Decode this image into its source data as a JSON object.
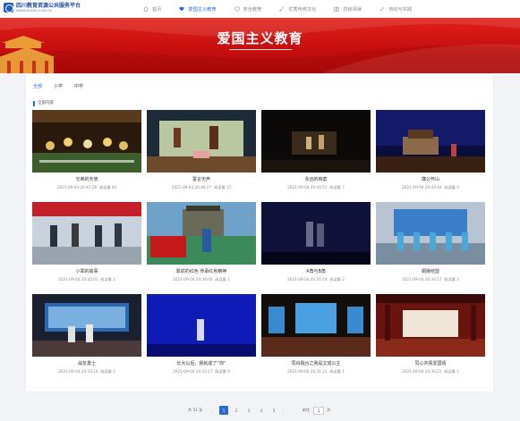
{
  "header": {
    "logo_title": "四川教育资源公共服务平台",
    "logo_url": "WWW.SCEDU.COM.CN",
    "nav": [
      {
        "label": "首页",
        "icon": "home-icon",
        "active": false
      },
      {
        "label": "爱国主义教育",
        "icon": "heart-icon",
        "active": true
      },
      {
        "label": "安全教育",
        "icon": "shield-icon",
        "active": false
      },
      {
        "label": "优秀传统文化",
        "icon": "brush-icon",
        "active": false
      },
      {
        "label": "抗疫阅读",
        "icon": "book-icon",
        "active": false
      },
      {
        "label": "劳动与实践",
        "icon": "tools-icon",
        "active": false
      }
    ]
  },
  "banner": {
    "title": "爱国主义教育"
  },
  "tabs": [
    {
      "label": "全部",
      "active": true
    },
    {
      "label": "小学",
      "active": false
    },
    {
      "label": "中学",
      "active": false
    }
  ],
  "section_label": "全部内容",
  "views_label": "阅读量",
  "items": [
    {
      "title": "光荣的天使",
      "date": "2021-09-04 20:47:26",
      "views": "44"
    },
    {
      "title": "誓言无声",
      "date": "2021-09-04 20:46:27",
      "views": "17"
    },
    {
      "title": "永远的档案",
      "date": "2021-09-04 20:44:51",
      "views": "7"
    },
    {
      "title": "廉公怀山",
      "date": "2021-09-04 20:43:44",
      "views": "4"
    },
    {
      "title": "小郑的故事",
      "date": "2021-09-04 20:42:01",
      "views": "2"
    },
    {
      "title": "靠前的红色 传承红色精神",
      "date": "2021-09-04 20:36:00",
      "views": "1"
    },
    {
      "title": "A角与B角",
      "date": "2021-09-04 20:35:14",
      "views": "2"
    },
    {
      "title": "銅陵结盟",
      "date": "2021-09-04 20:34:17",
      "views": "3"
    },
    {
      "title": "战友勇士",
      "date": "2021-09-04 20:33:10",
      "views": "2"
    },
    {
      "title": "长大以后，我就成了“你”",
      "date": "2021-09-04 20:32:17",
      "views": "0"
    },
    {
      "title": "同舟融合之我是文成公主",
      "date": "2021-09-04 20:31:21",
      "views": "1"
    },
    {
      "title": "同心共情爱国情",
      "date": "2021-09-04 20:30:21",
      "views": "1"
    }
  ],
  "pagination": {
    "total": "共 51 条",
    "prev": "‹",
    "next": "›",
    "pages": [
      "1",
      "2",
      "3",
      "4",
      "5"
    ],
    "current": "1",
    "goto_label": "前往",
    "goto_value": "1",
    "goto_unit": "页"
  },
  "colors": {
    "accent": "#2a6ad8",
    "banner_red": "#d0141a"
  }
}
